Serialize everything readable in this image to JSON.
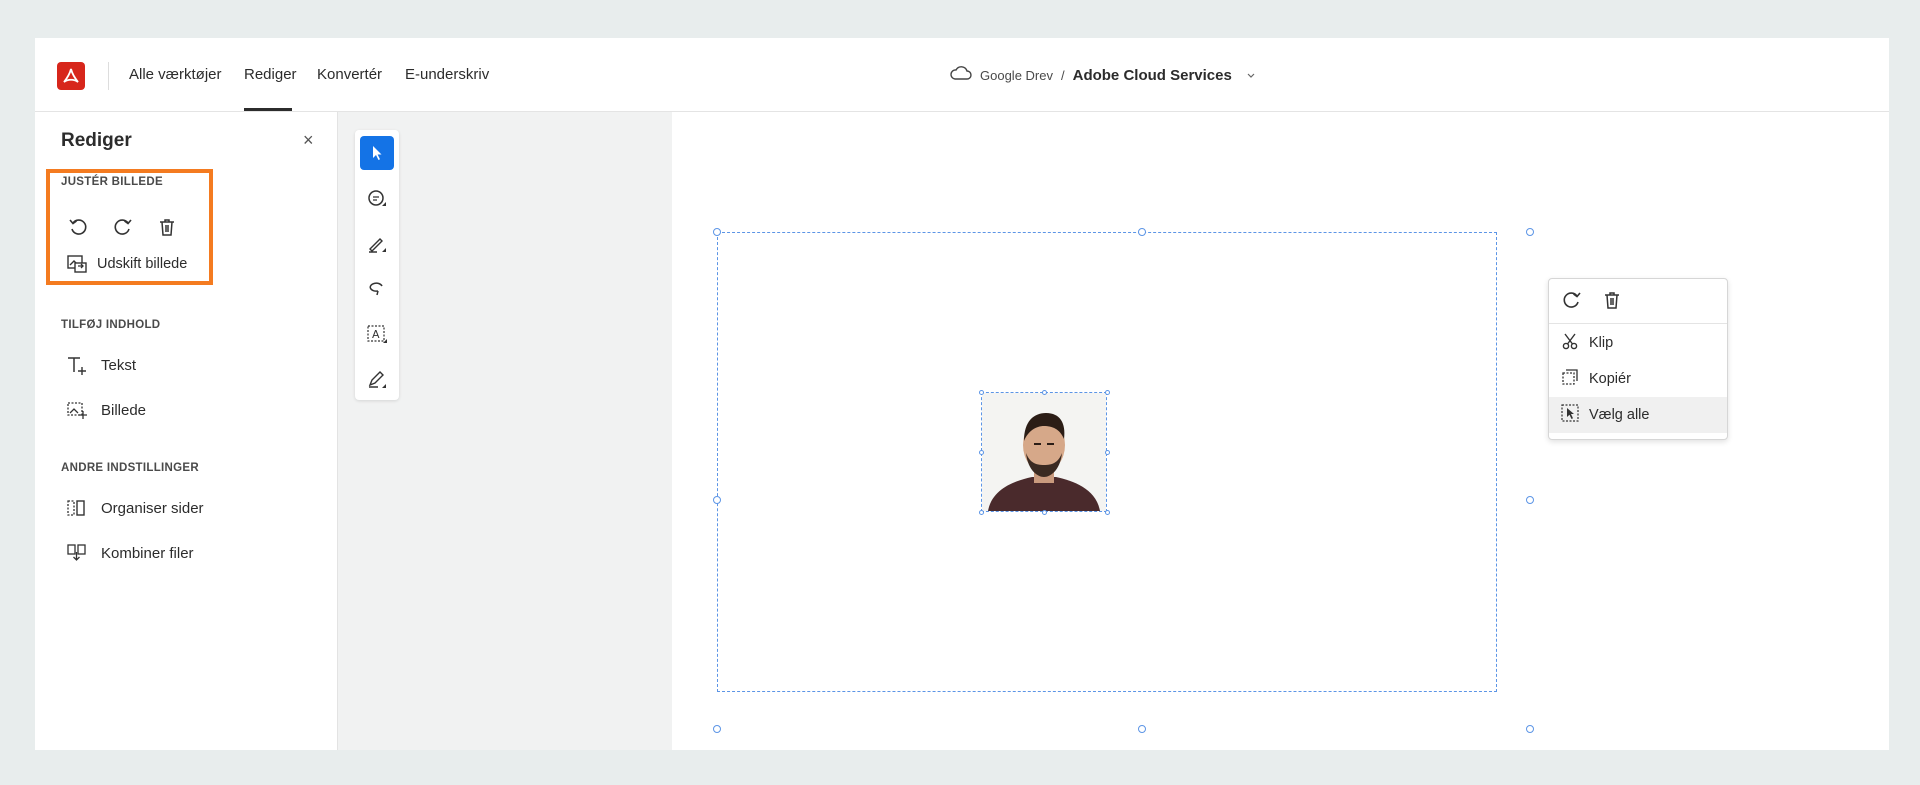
{
  "topbar": {
    "nav": [
      "Alle værktøjer",
      "Rediger",
      "Konvertér",
      "E-underskriv"
    ],
    "active_nav": "Rediger",
    "breadcrumb": {
      "location": "Google Drev",
      "separator": "/",
      "current": "Adobe Cloud Services"
    }
  },
  "panel": {
    "title": "Rediger",
    "close": "×",
    "sections": {
      "adjust": {
        "label": "JUSTÉR BILLEDE",
        "replace": "Udskift billede"
      },
      "add": {
        "label": "TILFØJ INDHOLD",
        "text": "Tekst",
        "image": "Billede"
      },
      "other": {
        "label": "ANDRE INDSTILLINGER",
        "organize": "Organiser sider",
        "combine": "Kombiner filer"
      }
    }
  },
  "context_menu": {
    "items": [
      "Klip",
      "Kopiér",
      "Vælg alle"
    ]
  },
  "colors": {
    "brand": "#d7261b",
    "accent": "#1473e6",
    "highlight": "#f47b20",
    "selection": "#5c95e6"
  }
}
